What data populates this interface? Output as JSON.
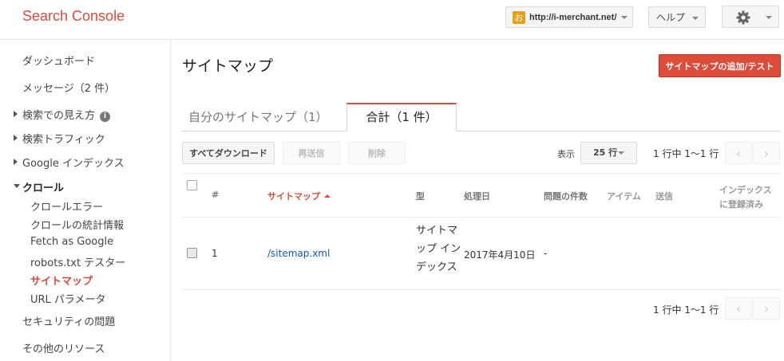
{
  "header": {
    "app_title": "Search Console",
    "site": {
      "favicon_char": "お",
      "url": "http://i-merchant.net/"
    },
    "help_label": "ヘルプ",
    "settings_icon": "gear-icon"
  },
  "sidebar": {
    "dashboard": "ダッシュボード",
    "messages": "メッセージ（2 件）",
    "search_appearance": "検索での見え方",
    "search_traffic": "検索トラフィック",
    "google_index": "Google インデックス",
    "crawl": "クロール",
    "crawl_items": {
      "errors": "クロールエラー",
      "stats": "クロールの統計情報",
      "fetch": "Fetch as Google",
      "robots": "robots.txt テスター",
      "sitemaps": "サイトマップ",
      "url_params": "URL パラメータ"
    },
    "security": "セキュリティの問題",
    "other": "その他のリソース"
  },
  "main": {
    "title": "サイトマップ",
    "add_button": "サイトマップの追加/テスト",
    "tabs": {
      "mine": "自分のサイトマップ（1）",
      "all": "合計（1 件）"
    },
    "toolbar": {
      "download": "すべてダウンロード",
      "resubmit": "再送信",
      "delete": "削除",
      "show_label": "表示",
      "rows": "25 行",
      "paging": "1 行中 1～1 行"
    },
    "table": {
      "headers": {
        "num": "#",
        "sitemap": "サイトマップ",
        "type": "型",
        "processed": "処理日",
        "issues": "問題の件数",
        "items": "アイテム",
        "submitted": "送信",
        "indexed_line1": "インデックス",
        "indexed_line2": "に登録済み"
      },
      "rows": [
        {
          "num": "1",
          "sitemap": "/sitemap.xml",
          "type": "サイトマップ インデックス",
          "processed": "2017年4月10日",
          "issues": "-"
        }
      ]
    },
    "footer_paging": "1 行中 1～1 行"
  }
}
